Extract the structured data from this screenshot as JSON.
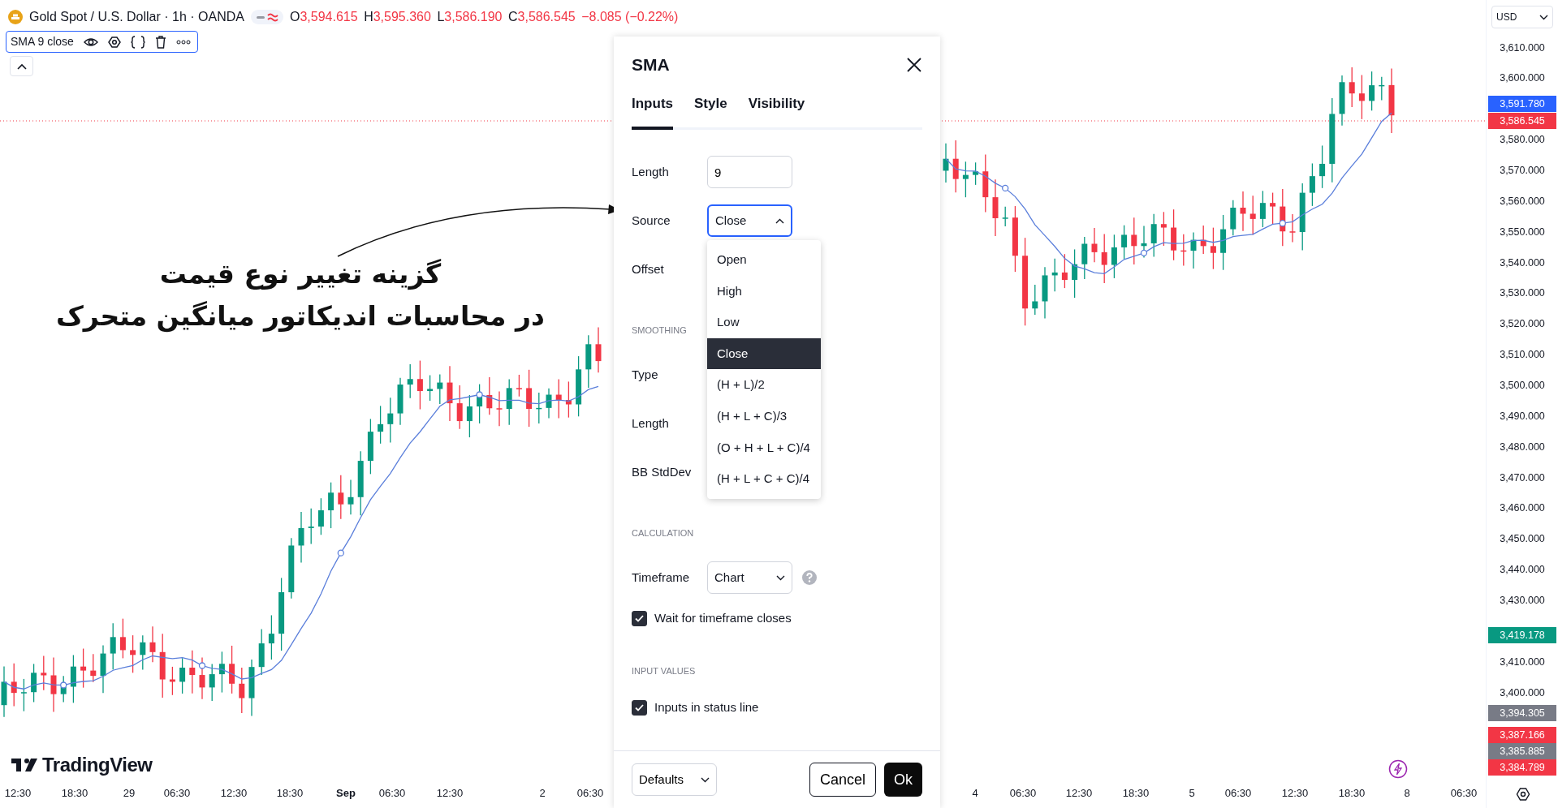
{
  "header": {
    "symbol": "Gold Spot / U.S. Dollar · 1h · OANDA",
    "ohlc": [
      {
        "label": "O",
        "value": "3,594.615"
      },
      {
        "label": "H",
        "value": "3,595.360"
      },
      {
        "label": "L",
        "value": "3,586.190"
      },
      {
        "label": "C",
        "value": "3,586.545"
      }
    ],
    "change": "−8.085 (−0.22%)"
  },
  "indicator_legend": {
    "title": "SMA 9 close"
  },
  "annotation": {
    "lines": [
      "گزینه تغییر نوع قیمت",
      "در محاسبات اندیکاتور میانگین متحرک"
    ]
  },
  "logo": {
    "text": "TradingView"
  },
  "dialog": {
    "title": "SMA",
    "tabs": [
      {
        "label": "Inputs",
        "selected": true
      },
      {
        "label": "Style",
        "selected": false
      },
      {
        "label": "Visibility",
        "selected": false
      }
    ],
    "rows": [
      {
        "kind": "input",
        "label": "Length",
        "value": "9"
      },
      {
        "kind": "select",
        "label": "Source",
        "value": "Close",
        "expanded": true,
        "options": [
          {
            "label": "Open",
            "selected": false
          },
          {
            "label": "High",
            "selected": false
          },
          {
            "label": "Low",
            "selected": false
          },
          {
            "label": "Close",
            "selected": true
          },
          {
            "label": "(H + L)/2",
            "selected": false
          },
          {
            "label": "(H + L + C)/3",
            "selected": false
          },
          {
            "label": "(O + H + L + C)/4",
            "selected": false
          },
          {
            "label": "(H + L + C + C)/4",
            "selected": false
          }
        ]
      },
      {
        "kind": "label",
        "label": "Offset"
      },
      {
        "kind": "section",
        "label": "SMOOTHING"
      },
      {
        "kind": "label",
        "label": "Type"
      },
      {
        "kind": "label",
        "label": "Length"
      },
      {
        "kind": "label",
        "label": "BB StdDev"
      },
      {
        "kind": "section",
        "label": "CALCULATION"
      },
      {
        "kind": "select",
        "label": "Timeframe",
        "value": "Chart",
        "expanded": false,
        "help": true
      },
      {
        "kind": "checkbox",
        "label": "Wait for timeframe closes",
        "checked": true
      },
      {
        "kind": "section",
        "label": "INPUT VALUES"
      },
      {
        "kind": "checkbox",
        "label": "Inputs in status line",
        "checked": true
      }
    ],
    "footer": {
      "defaults": "Defaults",
      "cancel": "Cancel",
      "ok": "Ok"
    }
  },
  "price_axis": {
    "currency": "USD",
    "ticks": [
      "3,610.000",
      "3,600.000",
      "3,580.000",
      "3,570.000",
      "3,560.000",
      "3,550.000",
      "3,540.000",
      "3,530.000",
      "3,520.000",
      "3,510.000",
      "3,500.000",
      "3,490.000",
      "3,480.000",
      "3,470.000",
      "3,460.000",
      "3,450.000",
      "3,440.000",
      "3,430.000",
      "3,410.000",
      "3,400.000"
    ],
    "tags": [
      {
        "value": "3,591.780",
        "color": "#2962ff"
      },
      {
        "value": "3,586.545",
        "color": "#f23645"
      },
      {
        "value": "3,419.178",
        "color": "#089981"
      },
      {
        "value": "3,394.305",
        "color": "#787b86"
      },
      {
        "value": "3,387.166",
        "color": "#f23645"
      },
      {
        "value": "3,385.885",
        "color": "#787b86"
      },
      {
        "value": "3,384.789",
        "color": "#f23645"
      }
    ]
  },
  "time_axis": {
    "labels": [
      {
        "label": "12:30",
        "bold": false
      },
      {
        "label": "18:30",
        "bold": false
      },
      {
        "label": "29",
        "bold": false
      },
      {
        "label": "06:30",
        "bold": false
      },
      {
        "label": "12:30",
        "bold": false
      },
      {
        "label": "18:30",
        "bold": false
      },
      {
        "label": "Sep",
        "bold": true
      },
      {
        "label": "06:30",
        "bold": false
      },
      {
        "label": "12:30",
        "bold": false
      },
      {
        "label": "2",
        "bold": false
      },
      {
        "label": "06:30",
        "bold": false
      },
      {
        "label": "4",
        "bold": false
      },
      {
        "label": "06:30",
        "bold": false
      },
      {
        "label": "12:30",
        "bold": false
      },
      {
        "label": "18:30",
        "bold": false
      },
      {
        "label": "5",
        "bold": false
      },
      {
        "label": "06:30",
        "bold": false
      },
      {
        "label": "12:30",
        "bold": false
      },
      {
        "label": "18:30",
        "bold": false
      },
      {
        "label": "8",
        "bold": false
      },
      {
        "label": "06:30",
        "bold": false
      }
    ]
  }
}
